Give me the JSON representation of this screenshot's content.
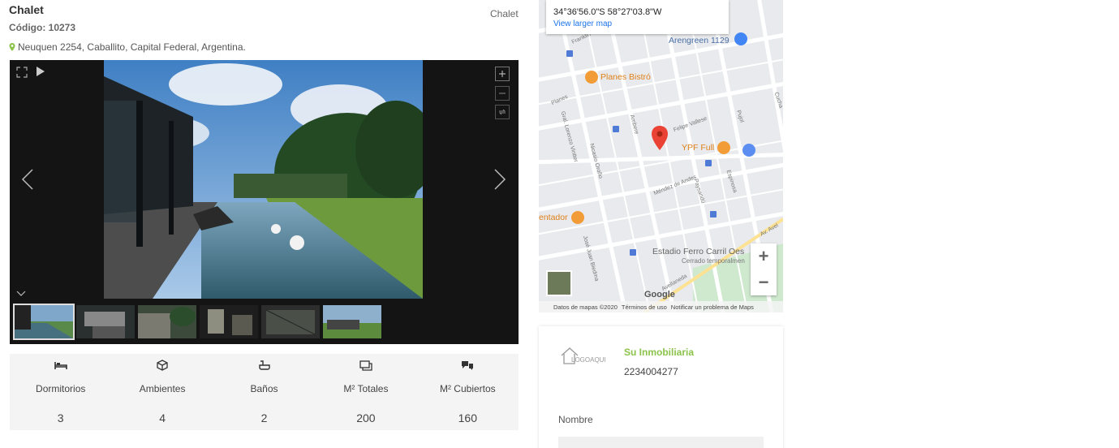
{
  "listing": {
    "title": "Chalet",
    "code": "Código: 10273",
    "address": "Neuquen 2254, Caballito, Capital Federal, Argentina.",
    "type": "Chalet"
  },
  "features": [
    {
      "icon": "bed-icon",
      "label": "Dormitorios",
      "value": "3"
    },
    {
      "icon": "cube-icon",
      "label": "Ambientes",
      "value": "4"
    },
    {
      "icon": "bath-icon",
      "label": "Baños",
      "value": "2"
    },
    {
      "icon": "area-icon",
      "label": "M² Totales",
      "value": "200"
    },
    {
      "icon": "covered-area-icon",
      "label": "M² Cubiertos",
      "value": "160"
    }
  ],
  "map": {
    "coords": "34°36'56.0\"S 58°27'03.8\"W",
    "larger_map": "View larger map",
    "labels": {
      "arengreen": "Arengreen 1129",
      "planes_bistro": "Planes Bistró",
      "ypf": "YPF Full",
      "entador": "entador",
      "estadio": "Estadio Ferro Carril Oes",
      "cerrado": "Cerrado temporalmen",
      "felipe": "Felipe Vallese",
      "mendez": "Méndez de Andes",
      "paysandu": "Paysandú",
      "espinosa": "Espinosa",
      "nicasio": "Nicasio Oroño",
      "jose": "José Juan Biedma",
      "lorenzo": "Gral. Lorenzo Vintter",
      "planes": "Planes",
      "franklin": "Franklin",
      "pujol": "Pujol",
      "cucha": "Cucha",
      "ambere": "Ambere",
      "avellaneda": "Avellaneda",
      "av": "Av. Avel"
    },
    "google": "Google",
    "footer": {
      "data": "Datos de mapas ©2020",
      "terms": "Términos de uso",
      "report": "Notificar un problema de Maps"
    },
    "zoom_in": "+",
    "zoom_out": "−"
  },
  "agent": {
    "logo_text": "LOGOAQUI",
    "name": "Su Inmobiliaria",
    "phone": "2234004277"
  },
  "form": {
    "name_label": "Nombre"
  },
  "colors": {
    "accent_green": "#8bc34a",
    "map_pin_red": "#ea4335",
    "poi_orange": "#f29c38"
  }
}
